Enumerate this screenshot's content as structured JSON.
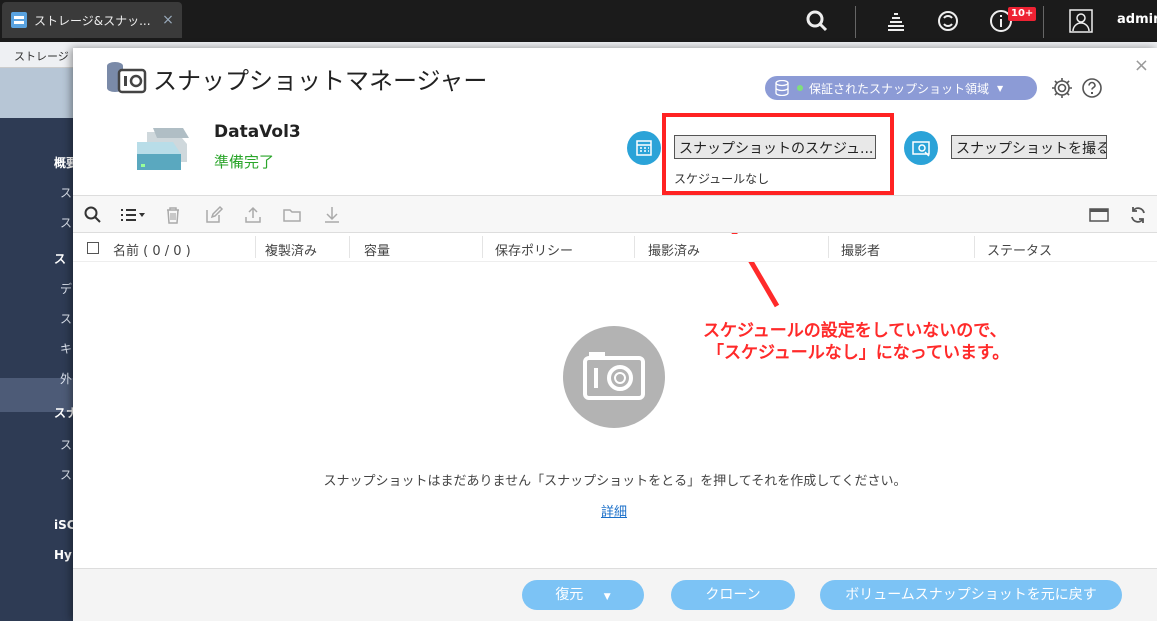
{
  "browser_tab": {
    "label": "ストレージ&スナッ...",
    "close": "×"
  },
  "topbar": {
    "notification_badge": "10+",
    "user": "admin"
  },
  "background_app": {
    "title": "ストレージ",
    "sidebar_items": [
      "概要",
      "ス",
      "ス",
      "ス",
      "デ",
      "ス",
      "キ",
      "外",
      "スナ",
      "ス",
      "ス",
      "iSC",
      "Hy"
    ]
  },
  "modal": {
    "title": "スナップショットマネージャー",
    "close": "×",
    "protected_space": "保証されたスナップショット領域",
    "volume": {
      "name": "DataVol3",
      "status": "準備完了"
    },
    "schedule_button": "スナップショットのスケジュ...",
    "schedule_status": "スケジュールなし",
    "take_snapshot_button": "スナップショットを撮る",
    "columns": [
      "名前 ( 0 / 0 )",
      "複製済み",
      "容量",
      "保存ポリシー",
      "撮影済み",
      "撮影者",
      "ステータス"
    ],
    "empty_message": "スナップショットはまだありません「スナップショットをとる」を押してそれを作成してください。",
    "detail_link": "詳細",
    "footer": {
      "restore": "復元",
      "clone": "クローン",
      "revert": "ボリュームスナップショットを元に戻す"
    }
  },
  "annotation": {
    "line1": "スケジュールの設定をしていないので、",
    "line2": "「スケジュールなし」になっています。"
  },
  "colors": {
    "accent": "#2ba3d8",
    "highlight": "#ff2222",
    "ready": "#2aa52a",
    "footer_button": "#7cc3f5"
  }
}
